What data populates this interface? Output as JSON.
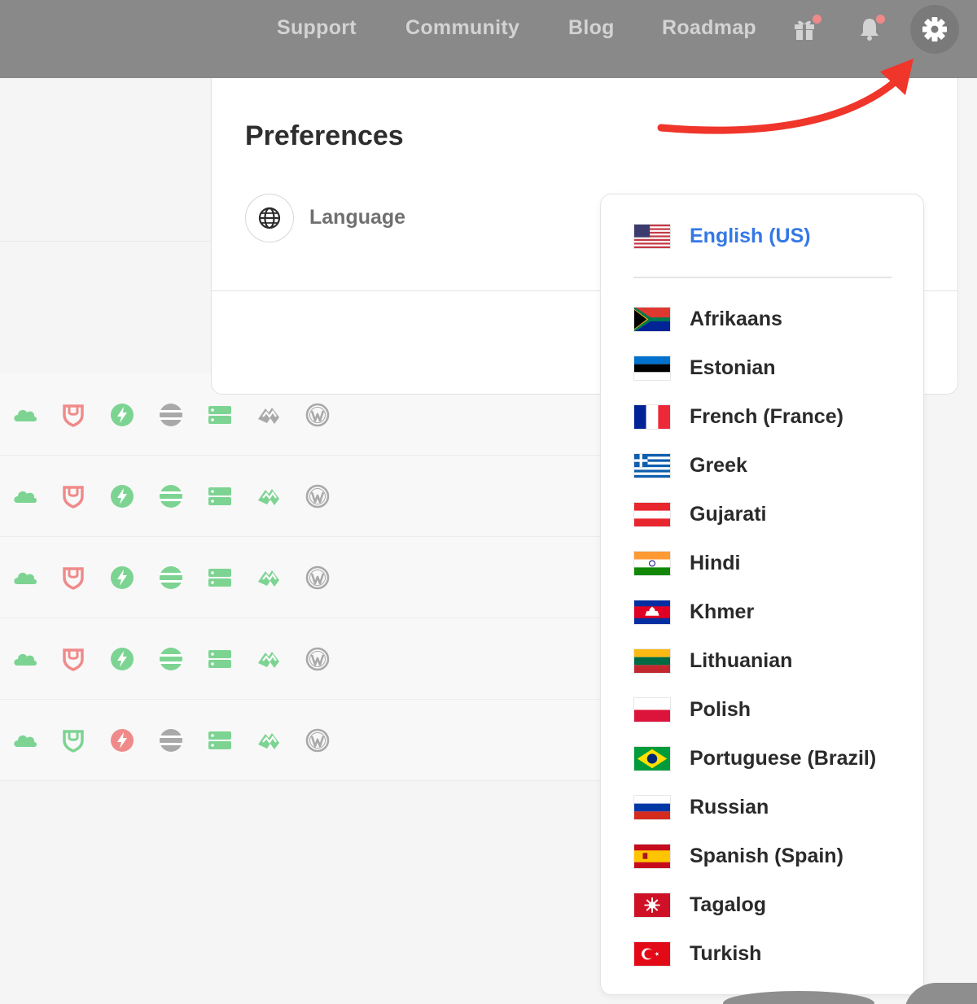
{
  "topbar": {
    "nav": [
      "Support",
      "Community",
      "Blog",
      "Roadmap"
    ],
    "icons": [
      "gift-icon",
      "bell-icon",
      "gear-icon"
    ],
    "background": "#898989"
  },
  "preferences": {
    "title": "Preferences",
    "language_label": "Language"
  },
  "language_menu": {
    "selected": "English (US)",
    "options": [
      "Afrikaans",
      "Estonian",
      "French (France)",
      "Greek",
      "Gujarati",
      "Hindi",
      "Khmer",
      "Lithuanian",
      "Polish",
      "Portuguese (Brazil)",
      "Russian",
      "Spanish (Spain)",
      "Tagalog",
      "Turkish"
    ],
    "accent_color": "#3478e5"
  },
  "status_rows": {
    "icon_names": [
      "cloud-icon",
      "shield-icon",
      "bolt-icon",
      "stack-icon",
      "server-icon",
      "peaks-icon",
      "wordpress-icon"
    ],
    "colors": {
      "ok": "#7dd492",
      "error": "#f08a8a",
      "neutral": "#a9a9a9"
    },
    "rows": [
      [
        "ok",
        "error",
        "ok",
        "neutral",
        "ok",
        "neutral",
        "neutral"
      ],
      [
        "ok",
        "error",
        "ok",
        "ok",
        "ok",
        "ok",
        "neutral"
      ],
      [
        "ok",
        "error",
        "ok",
        "ok",
        "ok",
        "ok",
        "neutral"
      ],
      [
        "ok",
        "error",
        "ok",
        "ok",
        "ok",
        "ok",
        "neutral"
      ],
      [
        "ok",
        "ok",
        "error",
        "neutral",
        "ok",
        "ok",
        "neutral"
      ]
    ]
  },
  "annotation": {
    "arrow_color": "#f0352a"
  }
}
